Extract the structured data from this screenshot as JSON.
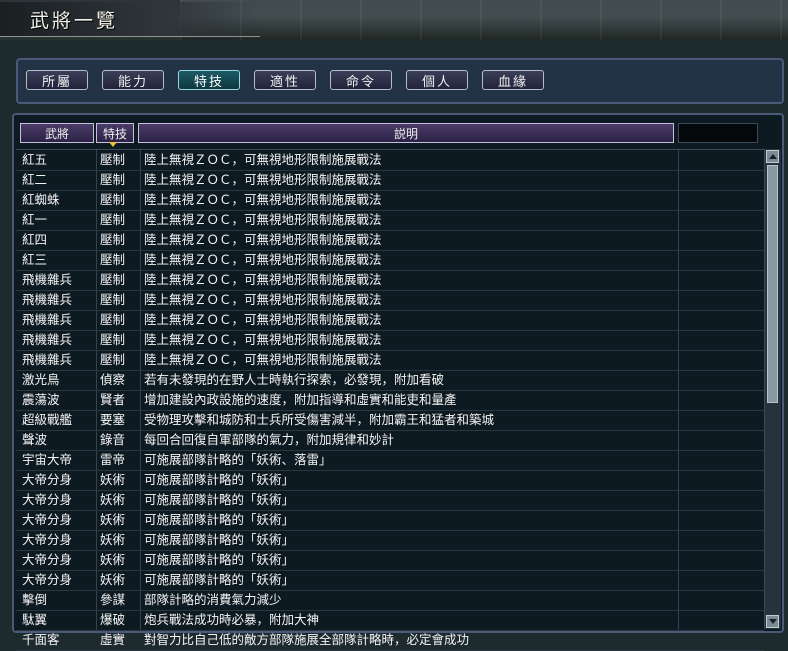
{
  "window": {
    "title": "武將一覽"
  },
  "tabs": [
    {
      "label": "所屬",
      "active": false
    },
    {
      "label": "能力",
      "active": false
    },
    {
      "label": "特技",
      "active": true
    },
    {
      "label": "適性",
      "active": false
    },
    {
      "label": "命令",
      "active": false
    },
    {
      "label": "個人",
      "active": false
    },
    {
      "label": "血緣",
      "active": false
    }
  ],
  "table": {
    "headers": {
      "name": "武將",
      "skill": "特技",
      "description": "説明",
      "extra": ""
    },
    "sorted_by": "skill",
    "rows": [
      [
        "紅五",
        "壓制",
        "陸上無視ＺＯＣ，可無視地形限制施展戰法"
      ],
      [
        "紅二",
        "壓制",
        "陸上無視ＺＯＣ，可無視地形限制施展戰法"
      ],
      [
        "紅蜘蛛",
        "壓制",
        "陸上無視ＺＯＣ，可無視地形限制施展戰法"
      ],
      [
        "紅一",
        "壓制",
        "陸上無視ＺＯＣ，可無視地形限制施展戰法"
      ],
      [
        "紅四",
        "壓制",
        "陸上無視ＺＯＣ，可無視地形限制施展戰法"
      ],
      [
        "紅三",
        "壓制",
        "陸上無視ＺＯＣ，可無視地形限制施展戰法"
      ],
      [
        "飛機雜兵",
        "壓制",
        "陸上無視ＺＯＣ，可無視地形限制施展戰法"
      ],
      [
        "飛機雜兵",
        "壓制",
        "陸上無視ＺＯＣ，可無視地形限制施展戰法"
      ],
      [
        "飛機雜兵",
        "壓制",
        "陸上無視ＺＯＣ，可無視地形限制施展戰法"
      ],
      [
        "飛機雜兵",
        "壓制",
        "陸上無視ＺＯＣ，可無視地形限制施展戰法"
      ],
      [
        "飛機雜兵",
        "壓制",
        "陸上無視ＺＯＣ，可無視地形限制施展戰法"
      ],
      [
        "激光鳥",
        "偵察",
        "若有未發現的在野人士時執行探索，必發現，附加看破"
      ],
      [
        "震蕩波",
        "賢者",
        "增加建設內政設施的速度，附加指導和虛實和能吏和量產"
      ],
      [
        "超級戰艦",
        "要塞",
        "受物理攻擊和城防和士兵所受傷害減半，附加霸王和猛者和築城"
      ],
      [
        "聲波",
        "錄音",
        "每回合回復自軍部隊的氣力，附加規律和妙計"
      ],
      [
        "宇宙大帝",
        "雷帝",
        "可施展部隊計略的「妖術、落雷」"
      ],
      [
        "大帝分身",
        "妖術",
        "可施展部隊計略的「妖術」"
      ],
      [
        "大帝分身",
        "妖術",
        "可施展部隊計略的「妖術」"
      ],
      [
        "大帝分身",
        "妖術",
        "可施展部隊計略的「妖術」"
      ],
      [
        "大帝分身",
        "妖術",
        "可施展部隊計略的「妖術」"
      ],
      [
        "大帝分身",
        "妖術",
        "可施展部隊計略的「妖術」"
      ],
      [
        "大帝分身",
        "妖術",
        "可施展部隊計略的「妖術」"
      ],
      [
        "擊倒",
        "參謀",
        "部隊計略的消費氣力減少"
      ],
      [
        "駄翼",
        "爆破",
        "炮兵戰法成功時必暴，附加大神"
      ],
      [
        "千面客",
        "虛實",
        "對智力比自己低的敵方部隊施展全部隊計略時，必定會成功"
      ]
    ]
  },
  "scrollbar": {
    "position": 0.0,
    "visible_fraction": 0.5
  }
}
